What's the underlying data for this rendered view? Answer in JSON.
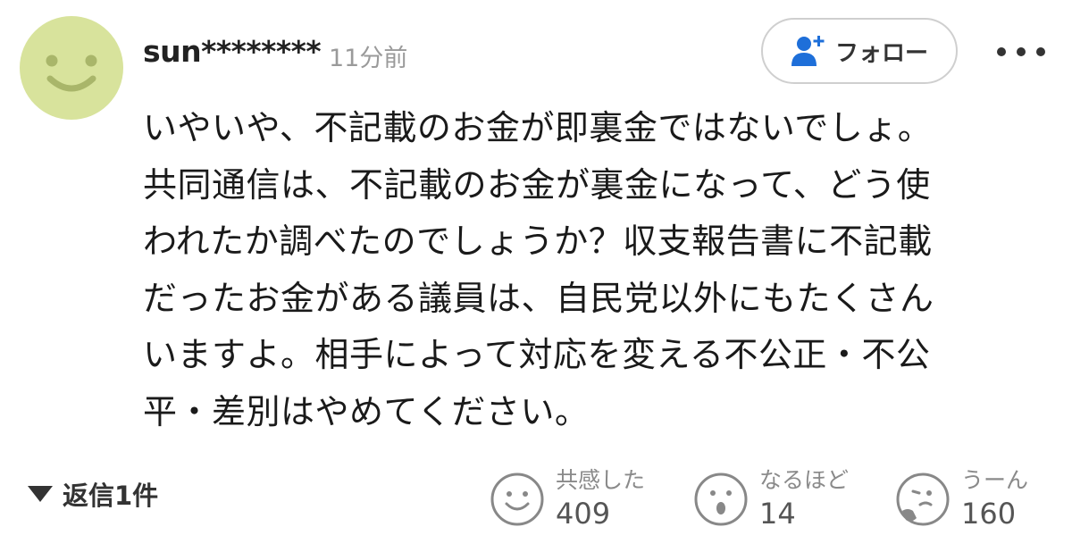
{
  "comment": {
    "user": {
      "name": "sun********",
      "avatar_color": "#d8e39c"
    },
    "timestamp": "11分前",
    "follow_label": "フォロー",
    "body_lines": [
      "いやいや、不記載のお金が即裏金ではないでしょ。",
      "共同通信は、不記載のお金が裏金になって、どう使",
      "われたか調べたのでしょうか？収支報告書に不記載",
      "だったお金がある議員は、自民党以外にもたくさん",
      "いますよ。相手によって対応を変える不公正・不公",
      "平・差別はやめてください。"
    ],
    "reply_label": "返信1件",
    "reactions": [
      {
        "label": "共感した",
        "count": "409",
        "icon": "smile-icon"
      },
      {
        "label": "なるほど",
        "count": "14",
        "icon": "surprised-icon"
      },
      {
        "label": "うーん",
        "count": "160",
        "icon": "thinking-icon"
      }
    ]
  },
  "colors": {
    "follow_icon": "#1e6fd9",
    "border": "#cfcfcf",
    "muted_text": "#9a9a9a"
  }
}
